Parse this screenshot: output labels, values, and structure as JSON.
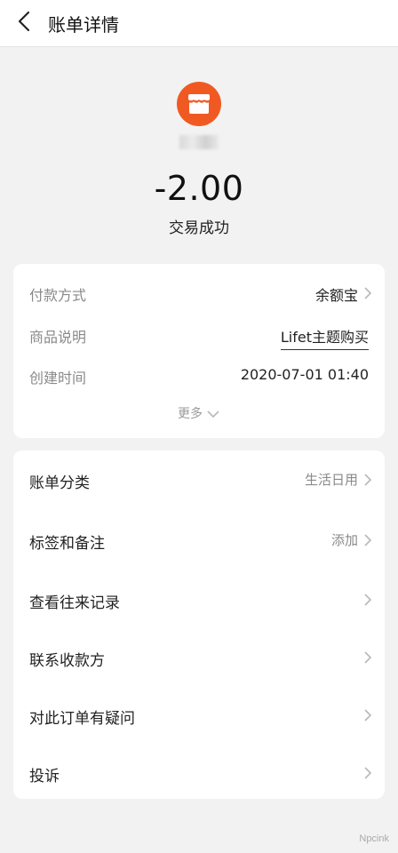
{
  "header": {
    "title": "账单详情"
  },
  "transaction": {
    "amount": "-2.00",
    "status": "交易成功"
  },
  "details": {
    "payment_method_label": "付款方式",
    "payment_method_value": "余额宝",
    "product_label": "商品说明",
    "product_value": "Lifet主题购买",
    "created_label": "创建时间",
    "created_value": "2020-07-01 01:40",
    "more_label": "更多"
  },
  "actions": {
    "category_label": "账单分类",
    "category_value": "生活日用",
    "tags_label": "标签和备注",
    "tags_value": "添加",
    "history_label": "查看往来记录",
    "contact_label": "联系收款方",
    "dispute_label": "对此订单有疑问",
    "complaint_label": "投诉"
  },
  "colors": {
    "accent": "#f05a22",
    "background": "#f2f2f2"
  },
  "watermark": "Npcink"
}
